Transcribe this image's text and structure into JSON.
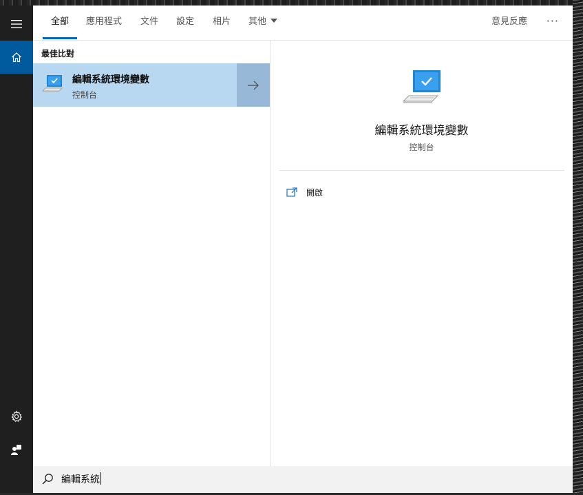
{
  "tabs": [
    {
      "label": "全部",
      "active": true
    },
    {
      "label": "應用程式",
      "active": false
    },
    {
      "label": "文件",
      "active": false
    },
    {
      "label": "設定",
      "active": false
    },
    {
      "label": "相片",
      "active": false
    },
    {
      "label": "其他",
      "active": false
    }
  ],
  "header": {
    "feedback_label": "意見反應",
    "more_label": "···"
  },
  "left_pane": {
    "section_label": "最佳比對",
    "best_match": {
      "title": "編輯系統環境變數",
      "subtitle": "控制台",
      "icon": "control-panel-monitor-icon"
    }
  },
  "detail": {
    "title": "編輯系統環境變數",
    "subtitle": "控制台",
    "action_label": "開啟",
    "action_icon": "open-icon"
  },
  "search": {
    "value": "編輯系統",
    "icon": "search-icon"
  },
  "rail": {
    "icons": [
      "hamburger-menu-icon",
      "home-icon",
      "gear-icon",
      "user-icon"
    ]
  },
  "colors": {
    "accent": "#0067c0",
    "selected_row": "#b8d7f1",
    "selected_arrow": "#97b9d7",
    "rail": "#1f1f1f",
    "rail_active": "#005a9e"
  }
}
